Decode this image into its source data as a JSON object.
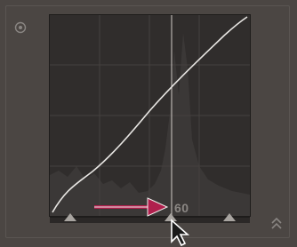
{
  "panel": {
    "title": "",
    "readout_value": "60"
  },
  "curve": {
    "type": "tone-curve",
    "midpoint_split": 60,
    "colors": {
      "background": "#302d2c",
      "curve": "#e8e6e3",
      "grid": "#4a4644",
      "histogram": "#3b3837",
      "marker_line": "#cfcac6",
      "annotation_arrow": "#b01f4d"
    }
  },
  "icons": {
    "target": "target-adjustment-icon",
    "expand": "expand-up-icon",
    "cursor": "mouse-pointer-icon"
  }
}
